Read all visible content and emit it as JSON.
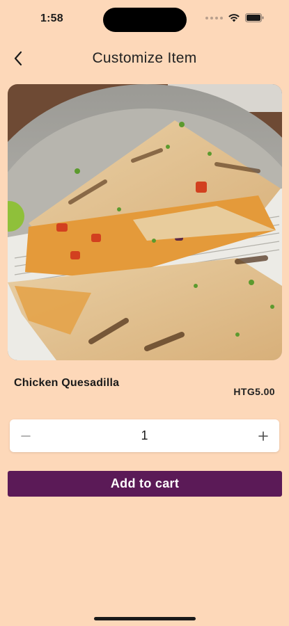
{
  "status_bar": {
    "time": "1:58"
  },
  "header": {
    "title": "Customize Item",
    "back_icon": "chevron-left-icon"
  },
  "item": {
    "image_alt": "Chicken quesadilla on a newspaper-lined plate",
    "name": "Chicken Quesadilla",
    "price": "HTG5.00"
  },
  "quantity": {
    "value": "1",
    "minus_icon": "minus-icon",
    "plus_icon": "plus-icon"
  },
  "actions": {
    "add_to_cart_label": "Add to cart"
  },
  "colors": {
    "background": "#fdd8b9",
    "primary": "#5b1a57"
  }
}
